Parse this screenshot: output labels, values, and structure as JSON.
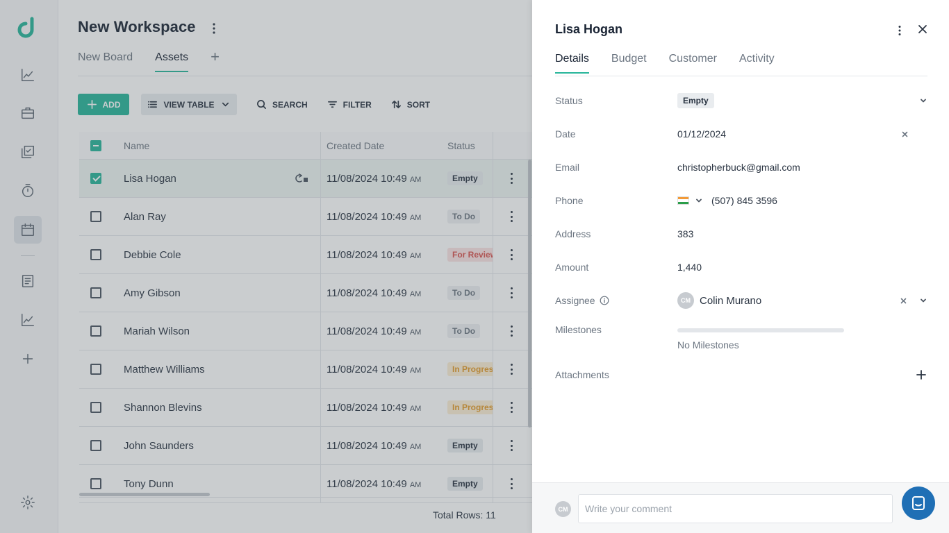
{
  "workspace": {
    "title": "New Workspace"
  },
  "tabs": [
    {
      "label": "New Board"
    },
    {
      "label": "Assets"
    }
  ],
  "toolbar": {
    "add_label": "ADD",
    "view_label": "VIEW TABLE",
    "search_label": "SEARCH",
    "filter_label": "FILTER",
    "sort_label": "SORT"
  },
  "table": {
    "headers": {
      "name": "Name",
      "created": "Created Date",
      "status": "Status"
    },
    "rows": [
      {
        "name": "Lisa Hogan",
        "date": "11/08/2024 10:49",
        "ampm": "AM",
        "status": "Empty"
      },
      {
        "name": "Alan Ray",
        "date": "11/08/2024 10:49",
        "ampm": "AM",
        "status": "To Do"
      },
      {
        "name": "Debbie Cole",
        "date": "11/08/2024 10:49",
        "ampm": "AM",
        "status": "For Review"
      },
      {
        "name": "Amy Gibson",
        "date": "11/08/2024 10:49",
        "ampm": "AM",
        "status": "To Do"
      },
      {
        "name": "Mariah Wilson",
        "date": "11/08/2024 10:49",
        "ampm": "AM",
        "status": "To Do"
      },
      {
        "name": "Matthew Williams",
        "date": "11/08/2024 10:49",
        "ampm": "AM",
        "status": "In Progress"
      },
      {
        "name": "Shannon Blevins",
        "date": "11/08/2024 10:49",
        "ampm": "AM",
        "status": "In Progress"
      },
      {
        "name": "John Saunders",
        "date": "11/08/2024 10:49",
        "ampm": "AM",
        "status": "Empty"
      },
      {
        "name": "Tony Dunn",
        "date": "11/08/2024 10:49",
        "ampm": "AM",
        "status": "Empty"
      }
    ],
    "total_rows": "Total Rows: 11"
  },
  "status_colors": {
    "Empty": {
      "bg": "#e9ecef",
      "fg": "#2a3442"
    },
    "To Do": {
      "bg": "#eef0f2",
      "fg": "#6c7682"
    },
    "For Review": {
      "bg": "#fbe2e2",
      "fg": "#d9534f"
    },
    "In Progress": {
      "bg": "#fdeed5",
      "fg": "#e39b2a"
    }
  },
  "panel": {
    "title": "Lisa Hogan",
    "tabs": [
      {
        "label": "Details"
      },
      {
        "label": "Budget"
      },
      {
        "label": "Customer"
      },
      {
        "label": "Activity"
      }
    ],
    "fields": {
      "status": {
        "label": "Status",
        "value": "Empty"
      },
      "date": {
        "label": "Date",
        "value": "01/12/2024"
      },
      "email": {
        "label": "Email",
        "value": "christopherbuck@gmail.com"
      },
      "phone": {
        "label": "Phone",
        "value": "(507) 845 3596"
      },
      "address": {
        "label": "Address",
        "value": "383"
      },
      "amount": {
        "label": "Amount",
        "value": "1,440"
      },
      "assignee": {
        "label": "Assignee",
        "value": "Colin Murano",
        "initials": "CM"
      },
      "milestones": {
        "label": "Milestones",
        "value": "No Milestones"
      },
      "attachments": {
        "label": "Attachments"
      }
    },
    "comment": {
      "avatar_initials": "CM",
      "placeholder": "Write your comment"
    }
  },
  "colors": {
    "accent": "#28b59a",
    "chat": "#1f6fb5"
  },
  "icons": [
    "logo-icon",
    "analytics-icon",
    "briefcase-icon",
    "tasks-icon",
    "timer-icon",
    "calendar-icon",
    "document-icon",
    "chart-icon",
    "plus-icon",
    "settings-icon",
    "chat-icon"
  ]
}
